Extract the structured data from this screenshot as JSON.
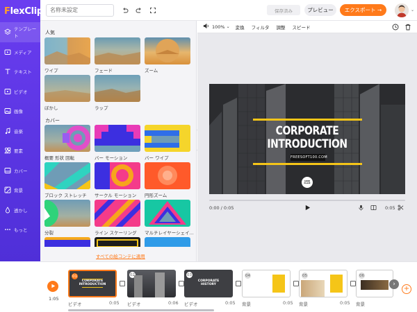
{
  "app": {
    "logo": "FlexClip",
    "logo_f": "F",
    "logo_rest": "lexClip"
  },
  "nav": [
    {
      "label": "テンプレート",
      "icon": "layers-icon"
    },
    {
      "label": "メディア",
      "icon": "media-folder-icon"
    },
    {
      "label": "テキスト",
      "icon": "text-icon"
    },
    {
      "label": "ビデオ",
      "icon": "video-icon"
    },
    {
      "label": "画像",
      "icon": "image-icon"
    },
    {
      "label": "音楽",
      "icon": "music-icon"
    },
    {
      "label": "要素",
      "icon": "elements-icon"
    },
    {
      "label": "カバー",
      "icon": "cover-icon"
    },
    {
      "label": "背景",
      "icon": "background-icon"
    },
    {
      "label": "透かし",
      "icon": "watermark-icon"
    },
    {
      "label": "もっと",
      "icon": "more-icon"
    }
  ],
  "topbar": {
    "project_placeholder": "名称未設定",
    "saved": "保存済み",
    "preview": "プレビュー",
    "export": "エクスポート →"
  },
  "panel": {
    "popular_title": "人気",
    "popular": [
      "ワイプ",
      "フェード",
      "ズーム",
      "ぼかし",
      "ラップ"
    ],
    "cover_title": "カバー",
    "cover": [
      "概要 形状 回転",
      "バー モーション",
      "バー ワイプ",
      "ブロック ストレッチ",
      "サークル モーション",
      "円形ズーム",
      "分裂",
      "ライン スケーリング",
      "マルチレイヤーシェイ..."
    ],
    "apply_all": "すべての絵コンテに適用"
  },
  "canvas_toolbar": {
    "zoom": "100%",
    "zoom_arrow": "⌄",
    "items": [
      "変換",
      "フィルタ",
      "調整",
      "スピード"
    ]
  },
  "video": {
    "title1": "CORPORATE",
    "title2": "INTRODUCTION",
    "site": "FREESOFT100.COM",
    "badge": "GOOD PLACE"
  },
  "player": {
    "time": "0:00 / 0:05",
    "duration": "0:05"
  },
  "timeline": {
    "total": "1:05",
    "clips": [
      {
        "num": "01",
        "label": "ビデオ",
        "dur": "0:05",
        "thumb1": "CORPORATE",
        "thumb2": "INTRODUCTION"
      },
      {
        "num": "02",
        "label": "ビデオ",
        "dur": "0:06",
        "thumb1": "",
        "thumb2": ""
      },
      {
        "num": "03",
        "label": "ビデオ",
        "dur": "0:05",
        "thumb1": "CORPORATE",
        "thumb2": "HISTORY"
      },
      {
        "num": "04",
        "label": "背景",
        "dur": "0:05",
        "thumb1": "",
        "thumb2": ""
      },
      {
        "num": "05",
        "label": "背景",
        "dur": "0:05",
        "thumb1": "",
        "thumb2": ""
      },
      {
        "num": "06",
        "label": "背景",
        "dur": "",
        "thumb1": "",
        "thumb2": ""
      }
    ]
  },
  "colors": {
    "sidebar": "#5a35e6",
    "accent": "#ff7a1a",
    "yellow": "#f5c518"
  }
}
